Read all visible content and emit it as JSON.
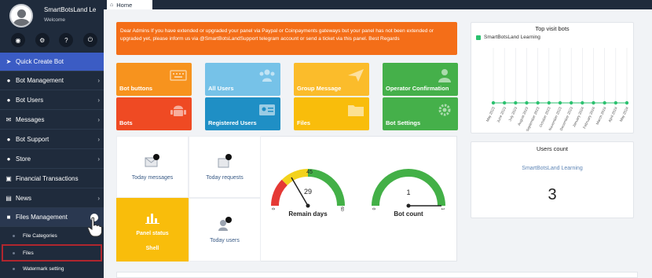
{
  "sidebar": {
    "profile": {
      "name": "SmartBotsLand Lea",
      "subtitle": "Welcome"
    },
    "quick_icons": [
      "user-icon",
      "wrench-icon",
      "help-icon",
      "power-icon"
    ],
    "items": [
      {
        "label": "Quick Create Bot",
        "icon": "rocket-icon"
      },
      {
        "label": "Bot Management",
        "icon": "robot-icon"
      },
      {
        "label": "Bot Users",
        "icon": "users-icon"
      },
      {
        "label": "Messages",
        "icon": "envelope-icon"
      },
      {
        "label": "Bot Support",
        "icon": "headset-icon"
      },
      {
        "label": "Store",
        "icon": "store-icon"
      },
      {
        "label": "Financial Transactions",
        "icon": "money-icon"
      },
      {
        "label": "News",
        "icon": "news-icon"
      },
      {
        "label": "Files Management",
        "icon": "folder-icon"
      }
    ],
    "subitems": [
      {
        "label": "File Categories"
      },
      {
        "label": "Files"
      },
      {
        "label": "Watermark setting"
      }
    ]
  },
  "topbar": {
    "home_label": "Home"
  },
  "alert": {
    "text": "Dear Admins If you have extended or upgraded your panel via Paypal or Coinpayments gateways but your panel has not been extended or upgraded yet, please inform us via @SmartBotsLandSupport telegram account or send a ticket via this panel. Best Regards"
  },
  "tiles": [
    {
      "label": "Bot buttons",
      "color": "#f7931e",
      "icon": "keyboard-icon"
    },
    {
      "label": "All Users",
      "color": "#76c2e8",
      "icon": "users-group-icon"
    },
    {
      "label": "Group Message",
      "color": "#fbbc2b",
      "icon": "send-icon"
    },
    {
      "label": "Operator Confirmation",
      "color": "#45b04a",
      "icon": "operator-icon"
    },
    {
      "label": "Bots",
      "color": "#ef4a23",
      "icon": "android-icon"
    },
    {
      "label": "Registered Users",
      "color": "#1f8fc5",
      "icon": "id-card-icon"
    },
    {
      "label": "Files",
      "color": "#f9bd0b",
      "icon": "folder-icon"
    },
    {
      "label": "Bot Settings",
      "color": "#45b04a",
      "icon": "gears-icon"
    }
  ],
  "stats": {
    "today_messages": "Today messages",
    "today_requests": "Today requests",
    "panel_status": "Panel status",
    "panel_plan": "Shell",
    "today_users": "Today users"
  },
  "gauges": {
    "remain_days": {
      "label": "Remain days",
      "value": 29,
      "max_label": "45",
      "min": 0,
      "max": 60
    },
    "bot_count": {
      "label": "Bot count",
      "value": 1,
      "min": 0,
      "max": 1
    }
  },
  "chart_data": {
    "type": "line",
    "title": "Top visit bots",
    "categories": [
      "May 2023",
      "June 2023",
      "July 2023",
      "August 2023",
      "September 2023",
      "October 2023",
      "November 2023",
      "December 2023",
      "January 2024",
      "February 2024",
      "March 2024",
      "April 2024",
      "May 2024"
    ],
    "series": [
      {
        "name": "SmartBotsLand Learning",
        "values": [
          0,
          0,
          0,
          0,
          0,
          0,
          0,
          0,
          0,
          0,
          0,
          0,
          0
        ],
        "color": "#2bc16f"
      }
    ],
    "legend": "top-left",
    "grid": true
  },
  "users_count": {
    "title": "Users count",
    "bot_name": "SmartBotsLand Learning",
    "count": "3"
  }
}
